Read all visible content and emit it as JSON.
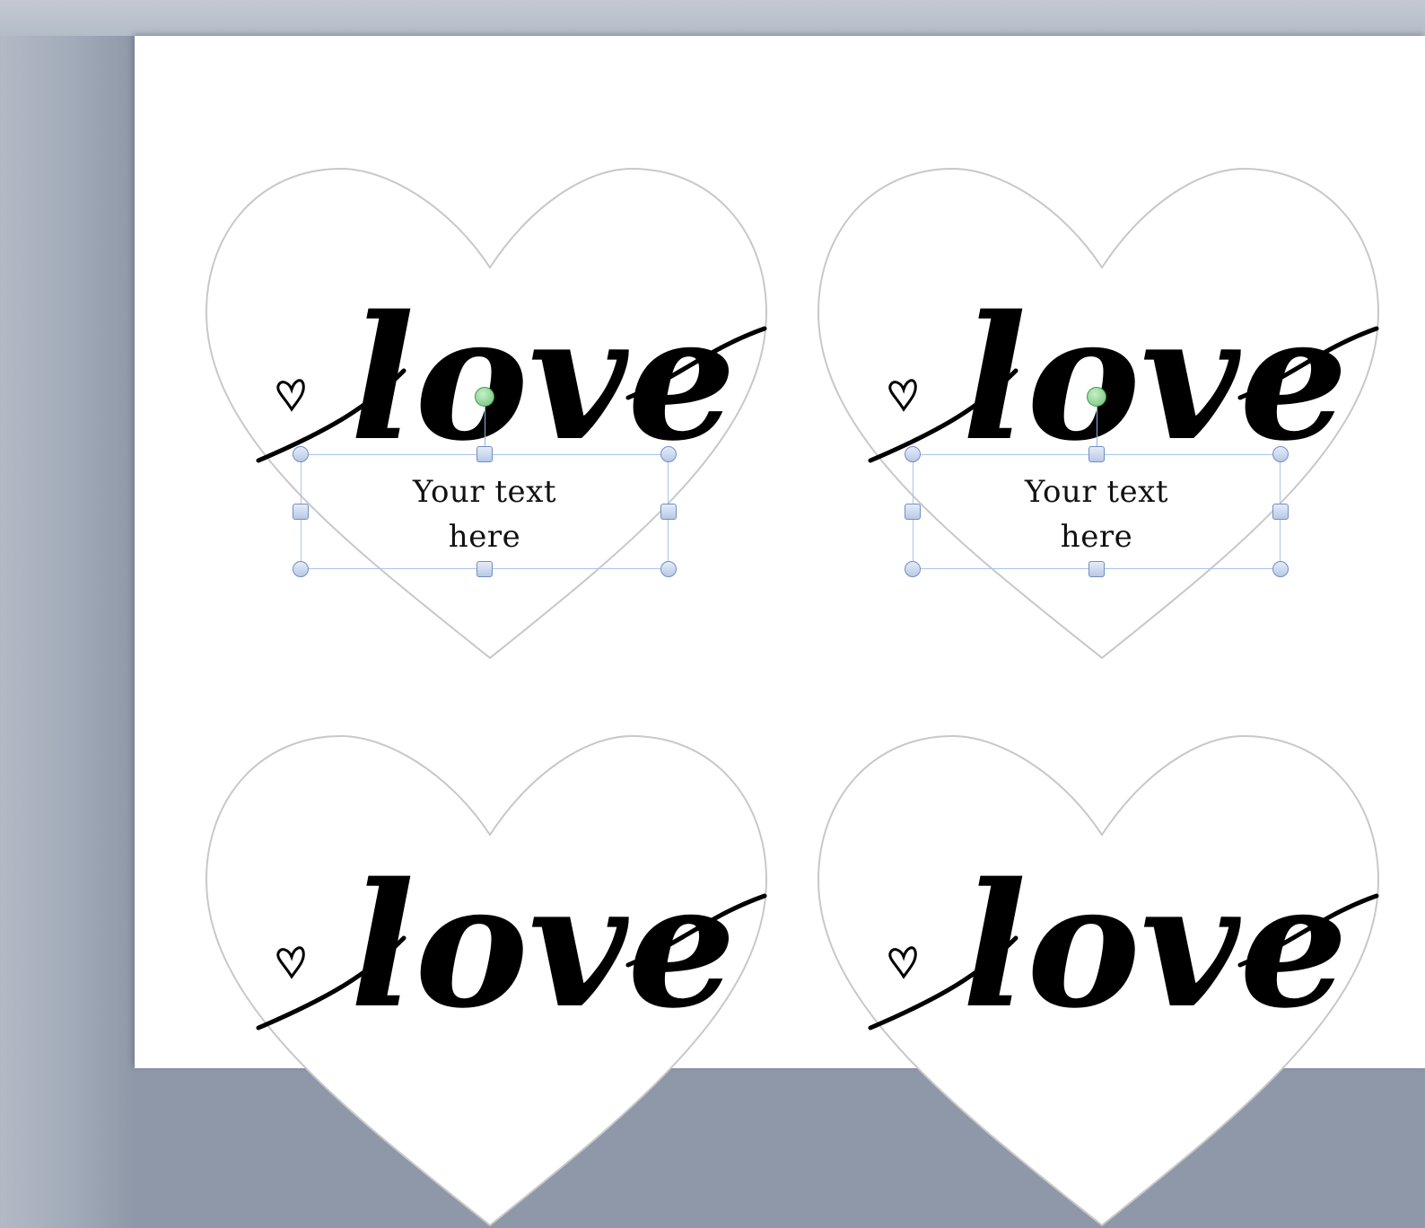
{
  "document": {
    "labels": [
      {
        "word": "love",
        "selected": true,
        "textbox": {
          "text": "Your text\nhere"
        }
      },
      {
        "word": "love",
        "selected": true,
        "textbox": {
          "text": "Your text\nhere"
        }
      },
      {
        "word": "love",
        "selected": false
      },
      {
        "word": "love",
        "selected": false
      }
    ]
  },
  "colors": {
    "workspace": "#a2abb9",
    "page": "#ffffff",
    "heart_outline": "#c8c8c8",
    "selection": "#a9c4ea",
    "rotation_handle": "#6cc276"
  },
  "icons": {
    "small_heart": "small-heart-doodle-icon",
    "selection_handles": "resize-handle-icon",
    "rotation": "rotate-handle-icon"
  }
}
